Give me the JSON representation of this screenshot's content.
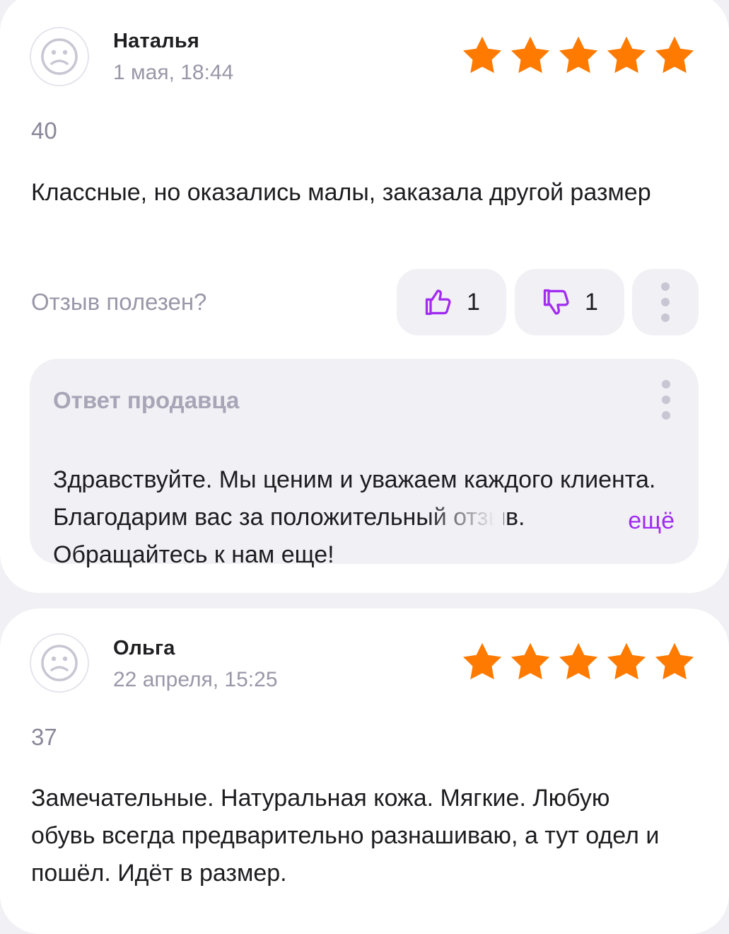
{
  "colors": {
    "star": "#ff7a00",
    "accent": "#a12cf0"
  },
  "reviews": [
    {
      "author": "Наталья",
      "date": "1 мая, 18:44",
      "rating": 5,
      "size": "40",
      "text": "Классные, но оказались малы, заказала другой размер",
      "helpful_label": "Отзыв полезен?",
      "likes": "1",
      "dislikes": "1",
      "seller_reply": {
        "title": "Ответ продавца",
        "text": "Здравствуйте. Мы ценим и уважаем каждого клиента. Благодарим вас за положительный отзыв. Обращайтесь к нам еще!",
        "more_label": "ещё"
      }
    },
    {
      "author": "Ольга",
      "date": "22 апреля, 15:25",
      "rating": 5,
      "size": "37",
      "text": "Замечательные. Натуральная кожа. Мягкие. Любую обувь всегда предварительно разнашиваю, а тут одел и пошёл. Идёт в размер."
    }
  ],
  "icons": {
    "avatar": "sad-face-icon",
    "star": "star-icon",
    "like": "thumbs-up-icon",
    "dislike": "thumbs-down-icon",
    "more": "more-vertical-icon"
  }
}
